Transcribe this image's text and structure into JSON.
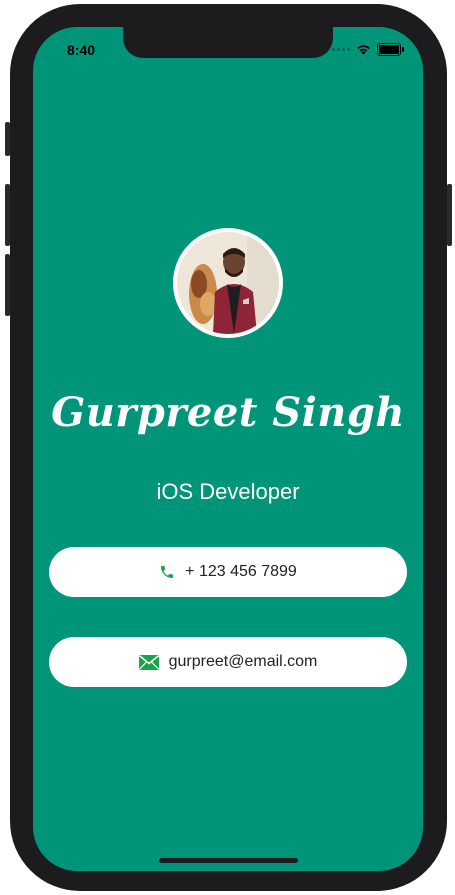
{
  "status_bar": {
    "time": "8:40",
    "wifi_icon": "wifi-icon",
    "battery_icon": "battery-icon"
  },
  "profile": {
    "name": "Gurpreet Singh",
    "title": "iOS Developer",
    "avatar_icon": "profile-photo"
  },
  "contacts": {
    "phone": {
      "icon": "phone-icon",
      "value": "+ 123 456 7899"
    },
    "email": {
      "icon": "envelope-icon",
      "value": "gurpreet@email.com"
    }
  },
  "colors": {
    "background": "#009479",
    "card": "#ffffff",
    "icon_accent": "#1aa34a",
    "device_frame": "#1c1c1e"
  }
}
